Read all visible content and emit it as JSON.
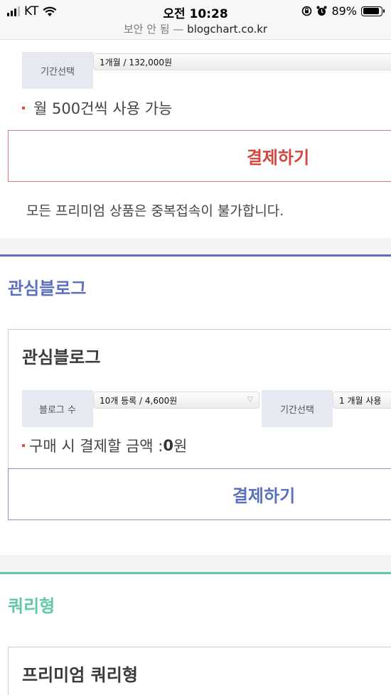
{
  "status_bar": {
    "carrier": "KT",
    "time": "오전 10:28",
    "battery": "89%",
    "battery_level": 0.89
  },
  "url_bar": {
    "security": "보안 안 됨 —",
    "host": "blogchart.co.kr"
  },
  "premium_top": {
    "period_label": "기간선택",
    "period_value": "1개월 / 132,000원",
    "feature": "월 500건씩 사용 가능",
    "pay_button": "결제하기",
    "notice": "모든 프리미엄 상품은 중복접속이 불가합니다."
  },
  "interest_blog": {
    "section_title": "관심블로그",
    "card_title": "관심블로그",
    "count_label": "블로그 수",
    "count_value": "10개 등록 / 4,600원",
    "period_label": "기간선택",
    "period_value": "1 개월 사용",
    "amount_prefix": "구매 시 결제할 금액 : ",
    "amount_value": "0",
    "amount_unit": "원",
    "pay_button": "결제하기"
  },
  "query_type": {
    "section_title": "쿼리형",
    "card_title": "프리미엄 쿼리형"
  },
  "colors": {
    "interest_accent": "#5b6fbe",
    "query_accent": "#5fc9a8",
    "pay_red": "#d2473f",
    "bullet": "#d9534f"
  }
}
